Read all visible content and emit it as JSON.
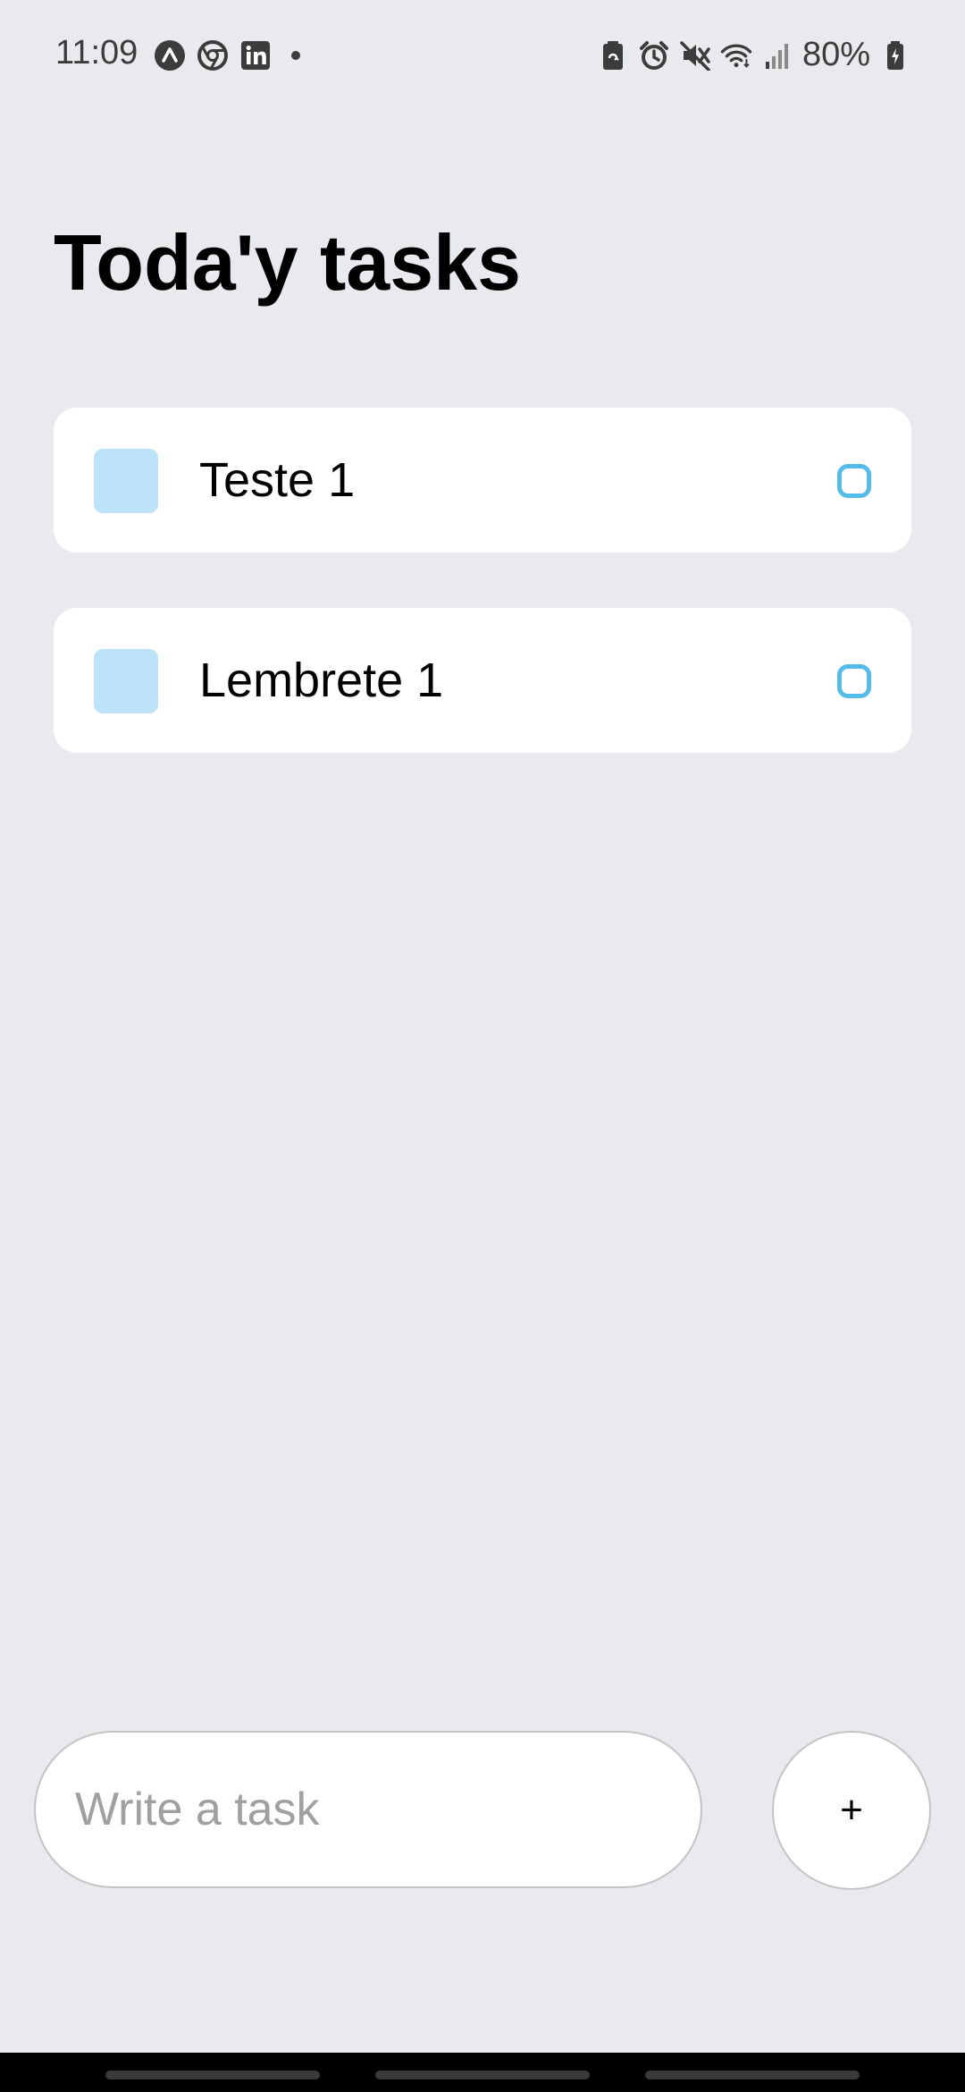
{
  "status_bar": {
    "time": "11:09",
    "battery": "80%",
    "left_icons": [
      "app-icon",
      "chrome-icon",
      "linkedin-icon",
      "notification-dot-icon"
    ],
    "right_icons": [
      "battery-saver-icon",
      "alarm-icon",
      "mute-icon",
      "wifi-icon",
      "signal-icon",
      "battery-icon"
    ]
  },
  "page": {
    "title": "Toda'y tasks"
  },
  "tasks": [
    {
      "text": "Teste 1"
    },
    {
      "text": "Lembrete 1"
    }
  ],
  "composer": {
    "placeholder": "Write a task",
    "value": "",
    "add_label": "+"
  },
  "colors": {
    "background": "#E8EAED",
    "card": "#FFFFFF",
    "square": "#BDE3F9",
    "circle_accent": "#55BCEA"
  }
}
